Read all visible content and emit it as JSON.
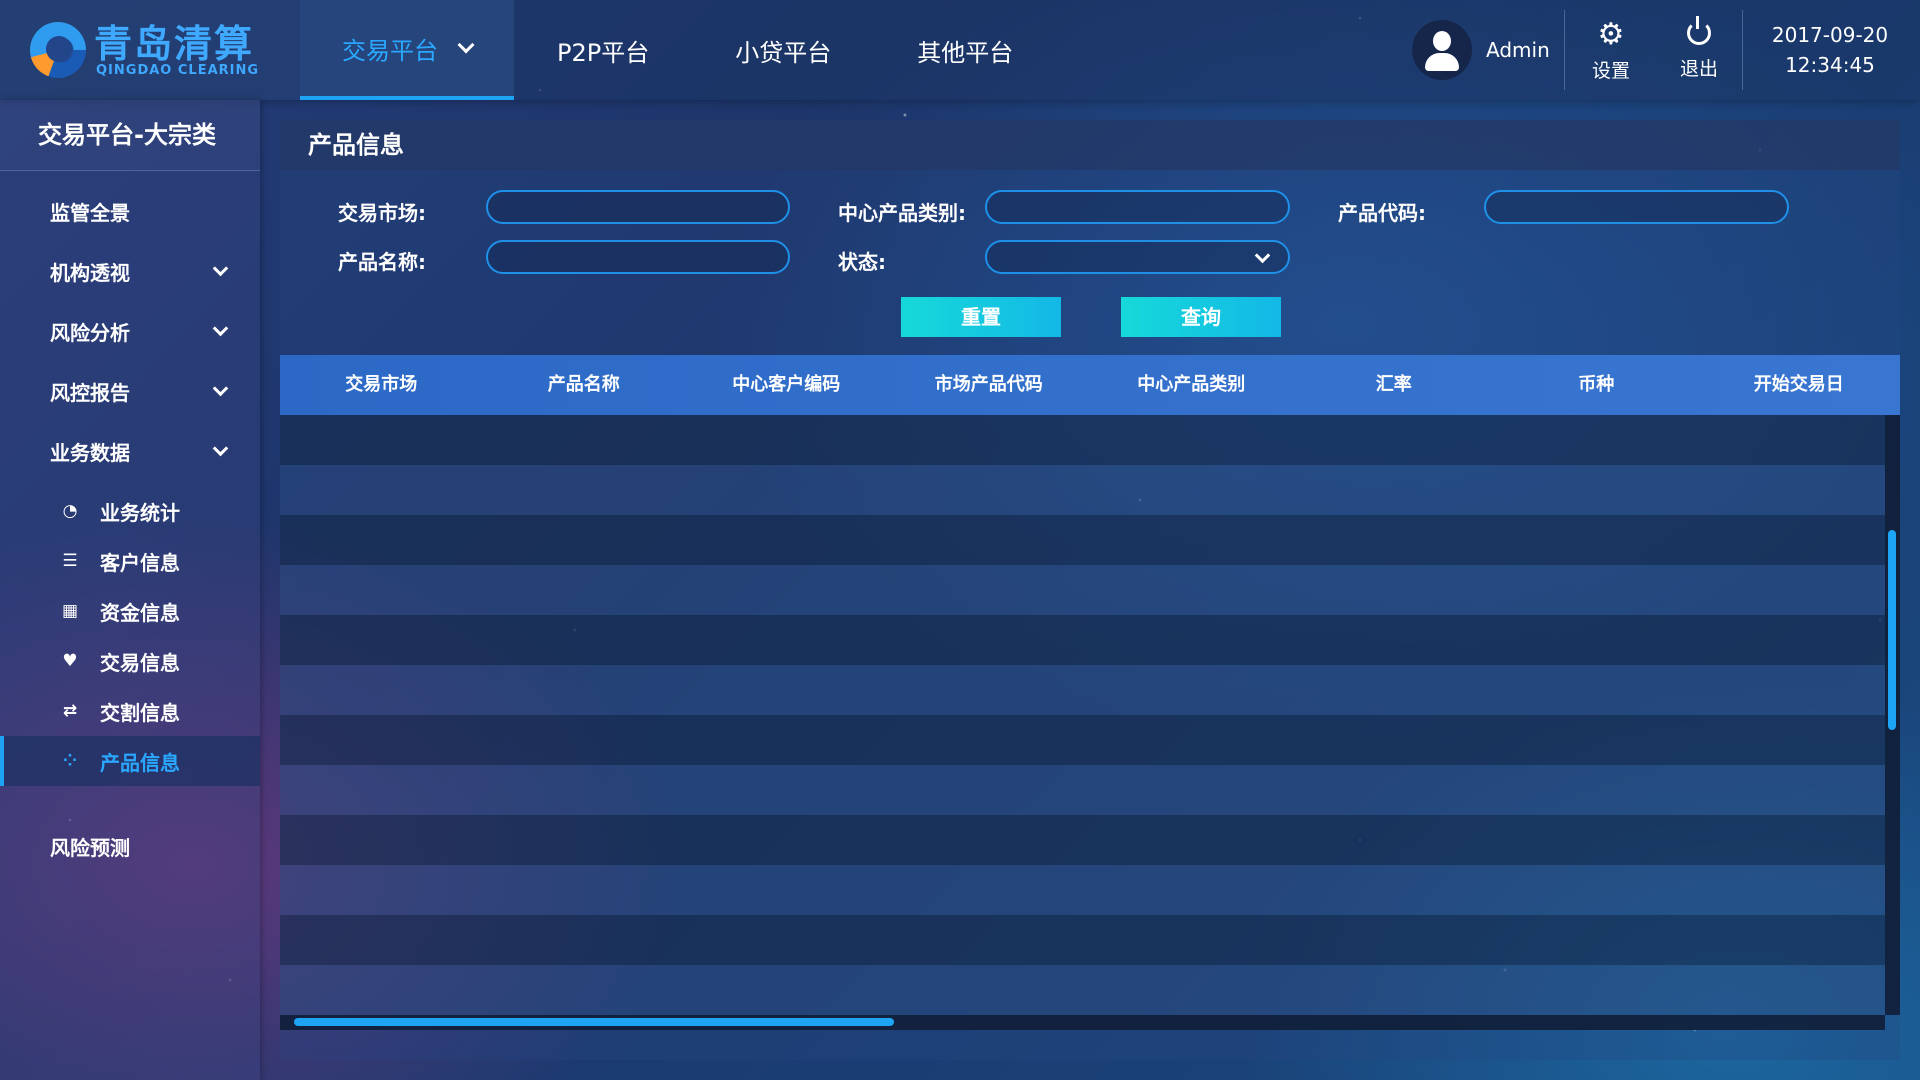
{
  "brand": {
    "name_cn": "青岛清算",
    "name_en": "QINGDAO CLEARING"
  },
  "top_nav": [
    {
      "label": "交易平台",
      "active": true,
      "has_dropdown": true
    },
    {
      "label": "P2P平台",
      "active": false
    },
    {
      "label": "小贷平台",
      "active": false
    },
    {
      "label": "其他平台",
      "active": false
    }
  ],
  "user": {
    "name": "Admin",
    "avatar_icon": "user-icon"
  },
  "tools": {
    "settings_label": "设置",
    "settings_icon": "gear-icon",
    "logout_label": "退出",
    "logout_icon": "power-icon"
  },
  "datetime": {
    "date": "2017-09-20",
    "time": "12:34:45"
  },
  "sidebar": {
    "title": "交易平台-大宗类",
    "items": [
      {
        "label": "监管全景",
        "expandable": false
      },
      {
        "label": "机构透视",
        "expandable": true
      },
      {
        "label": "风险分析",
        "expandable": true
      },
      {
        "label": "风控报告",
        "expandable": true
      },
      {
        "label": "业务数据",
        "expandable": true,
        "expanded": true
      }
    ],
    "sub_items": [
      {
        "label": "业务统计",
        "icon": "pie-chart-icon"
      },
      {
        "label": "客户信息",
        "icon": "user-list-icon"
      },
      {
        "label": "资金信息",
        "icon": "calculator-icon"
      },
      {
        "label": "交易信息",
        "icon": "handshake-icon"
      },
      {
        "label": "交割信息",
        "icon": "exchange-icon"
      },
      {
        "label": "产品信息",
        "icon": "grid-dots-icon",
        "active": true
      }
    ],
    "footer_item": {
      "label": "风险预测"
    }
  },
  "panel": {
    "title": "产品信息",
    "form": {
      "market_label": "交易市场:",
      "market_value": "",
      "category_label": "中心产品类别:",
      "category_value": "",
      "code_label": "产品代码:",
      "code_value": "",
      "name_label": "产品名称:",
      "name_value": "",
      "status_label": "状态:",
      "status_value": ""
    },
    "buttons": {
      "reset": "重置",
      "query": "查询"
    },
    "table": {
      "columns": [
        "交易市场",
        "产品名称",
        "中心客户编码",
        "市场产品代码",
        "中心产品类别",
        "汇率",
        "币种",
        "开始交易日"
      ],
      "rows": []
    }
  },
  "colors": {
    "accent": "#1ea4f5",
    "button_gradient_start": "#16d9d9",
    "button_gradient_end": "#13b8e6",
    "table_header": "#3370cc"
  }
}
